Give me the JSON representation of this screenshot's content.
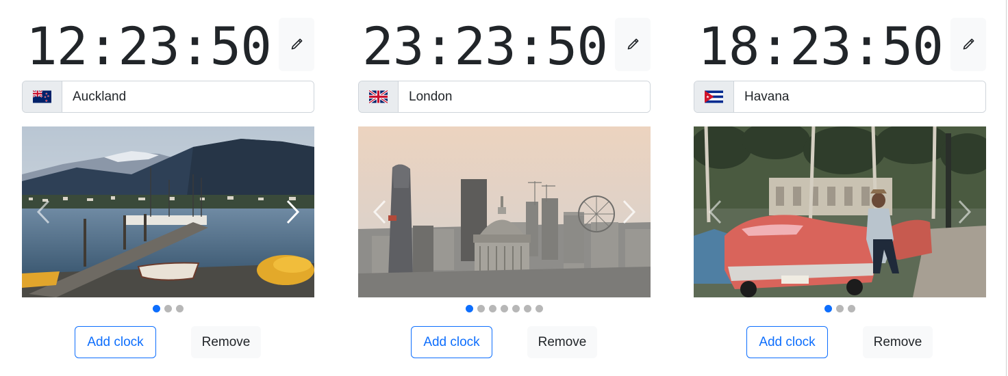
{
  "clocks": [
    {
      "time": "12:23:50",
      "city": "Auckland",
      "flag": "new-zealand-flag",
      "slides_total": 3,
      "active_slide": 1,
      "add_label": "Add clock",
      "remove_label": "Remove",
      "photo": "auckland-lakefront-photo"
    },
    {
      "time": "23:23:50",
      "city": "London",
      "flag": "united-kingdom-flag",
      "slides_total": 7,
      "active_slide": 1,
      "add_label": "Add clock",
      "remove_label": "Remove",
      "photo": "london-skyline-photo"
    },
    {
      "time": "18:23:50",
      "city": "Havana",
      "flag": "cuba-flag",
      "slides_total": 3,
      "active_slide": 1,
      "add_label": "Add clock",
      "remove_label": "Remove",
      "photo": "havana-vintage-cars-photo"
    }
  ],
  "icons": {
    "edit": "pencil-icon",
    "prev": "chevron-left-icon",
    "next": "chevron-right-icon"
  },
  "colors": {
    "accent": "#0d6efd",
    "text": "#212529",
    "addon_bg": "#e9ecef",
    "light_button_bg": "#f8f9fa",
    "border": "#ced4da",
    "dot_inactive": "#b7b7b7"
  }
}
